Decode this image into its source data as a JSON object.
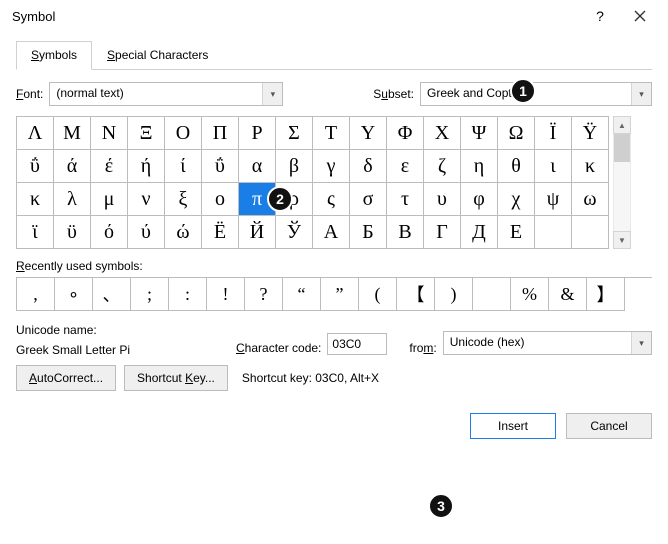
{
  "window": {
    "title": "Symbol"
  },
  "tabs": {
    "symbols": "Symbols",
    "special": "Special Characters"
  },
  "font": {
    "label": "Font:",
    "value": "(normal text)"
  },
  "subset": {
    "label": "Subset:",
    "value": "Greek and Coptic"
  },
  "grid": {
    "selected_index": 38,
    "chars": [
      "Λ",
      "Μ",
      "Ν",
      "Ξ",
      "Ο",
      "Π",
      "Ρ",
      "Σ",
      "Τ",
      "Υ",
      "Φ",
      "Χ",
      "Ψ",
      "Ω",
      "Ϊ",
      "Ϋ",
      "ΰ",
      "ά",
      "έ",
      "ή",
      "ί",
      "ΰ",
      "α",
      "β",
      "γ",
      "δ",
      "ε",
      "ζ",
      "η",
      "θ",
      "ι",
      "κ",
      "κ",
      "λ",
      "μ",
      "ν",
      "ξ",
      "ο",
      "π",
      "ρ",
      "ς",
      "σ",
      "τ",
      "υ",
      "φ",
      "χ",
      "ψ",
      "ω",
      "ϊ",
      "ϋ",
      "ό",
      "ύ",
      "ώ",
      "Ё",
      "Й",
      "Ў",
      "А",
      "Б",
      "В",
      "Г",
      "Д",
      "Е"
    ]
  },
  "recent": {
    "label": "Recently used symbols:",
    "chars": [
      ",",
      "∘",
      "、",
      ";",
      ":",
      "!",
      "?",
      "“",
      "”",
      "(",
      "【",
      ")",
      "",
      "%",
      "&",
      "】"
    ]
  },
  "unicode": {
    "label": "Unicode name:",
    "name": "Greek Small Letter Pi",
    "code_label": "Character code:",
    "code_value": "03C0",
    "from_label": "from:",
    "from_value": "Unicode (hex)"
  },
  "buttons": {
    "autocorrect": "AutoCorrect...",
    "shortcut": "Shortcut Key...",
    "shortcut_text": "Shortcut key: 03C0, Alt+X",
    "insert": "Insert",
    "cancel": "Cancel"
  },
  "callouts": {
    "one": "1",
    "two": "2",
    "three": "3"
  }
}
